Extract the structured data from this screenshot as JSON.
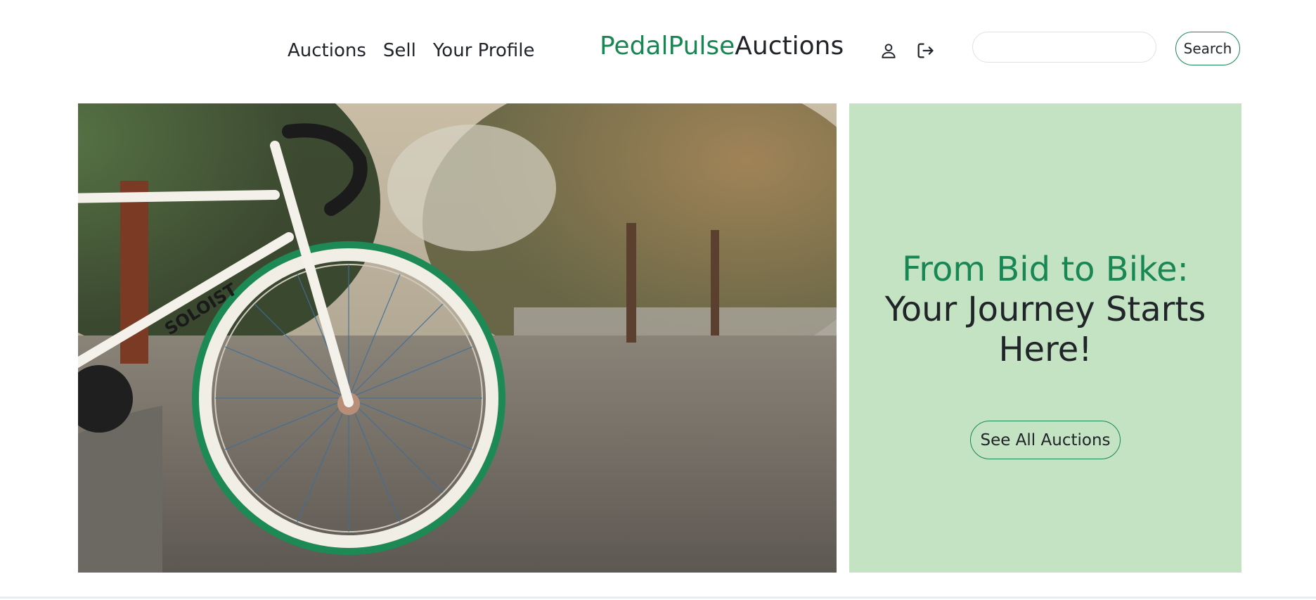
{
  "nav": {
    "items": [
      {
        "label": "Auctions"
      },
      {
        "label": "Sell"
      },
      {
        "label": "Your Profile"
      }
    ]
  },
  "logo": {
    "brand": "PedalPulse",
    "suffix": "Auctions"
  },
  "icons": {
    "profile": "person-icon",
    "logout": "logout-icon"
  },
  "search": {
    "value": "",
    "placeholder": "",
    "button_label": "Search"
  },
  "hero": {
    "image_label": "SOLOIST"
  },
  "promo": {
    "heading_accent": "From Bid to Bike:",
    "heading_rest": "Your Journey Starts Here!",
    "button_label": "See All Auctions"
  },
  "colors": {
    "accent": "#198754",
    "promo_bg": "#c3e3c3",
    "text": "#212529"
  }
}
